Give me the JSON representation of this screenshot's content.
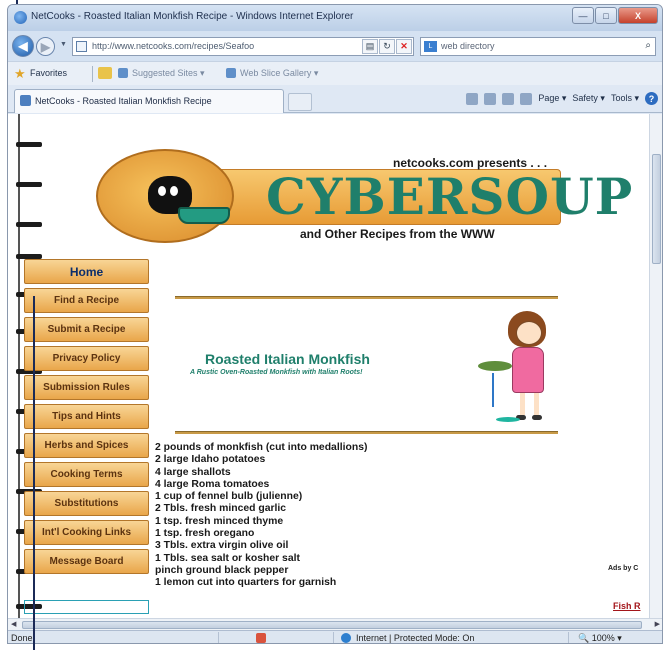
{
  "window": {
    "title": "NetCooks - Roasted Italian Monkfish Recipe - Windows Internet Explorer",
    "minimize_label": "—",
    "maximize_label": "□",
    "close_label": "X"
  },
  "address_bar": {
    "back_glyph": "◀",
    "forward_glyph": "▶",
    "url": "http://www.netcooks.com/recipes/Seafoo",
    "compat_glyph": "▤",
    "refresh_glyph": "↻",
    "stop_glyph": "✕",
    "search_placeholder": "web directory",
    "search_glyph": "⌕"
  },
  "favorites_bar": {
    "favorites_label": "Favorites",
    "links": [
      "Suggested Sites ▾",
      "Web Slice Gallery ▾"
    ]
  },
  "tabs": {
    "active_label": "NetCooks - Roasted Italian Monkfish Recipe"
  },
  "command_bar": {
    "items": [
      "Page ▾",
      "Safety ▾",
      "Tools ▾"
    ],
    "help_glyph": "?"
  },
  "site": {
    "presents": "netcooks.com presents . . .",
    "logo_text": "CYBERSOUP",
    "tagline": "and Other Recipes from the WWW"
  },
  "nav": {
    "items": [
      "Home",
      "Find a Recipe",
      "Submit a Recipe",
      "Privacy Policy",
      "Submission Rules",
      "Tips and Hints",
      "Herbs and Spices",
      "Cooking Terms",
      "Substitutions",
      "Int'l Cooking Links",
      "Message Board"
    ]
  },
  "recipe": {
    "title": "Roasted Italian Monkfish",
    "subtitle": "A Rustic Oven-Roasted Monkfish with Italian Roots!",
    "ingredients": [
      "2 pounds of monkfish (cut into medallions)",
      "2 large Idaho potatoes",
      "4 large shallots",
      "4 large Roma tomatoes",
      "1 cup of fennel bulb (julienne)",
      "2 Tbls. fresh minced garlic",
      "1 tsp. fresh minced thyme",
      "1 tsp. fresh oregano",
      "3 Tbls. extra virgin olive oil",
      "1 Tbls. sea salt or kosher salt",
      "pinch ground black pepper",
      "1 lemon cut into quarters for garnish"
    ]
  },
  "sidebar": {
    "ads_by": "Ads by C",
    "fish_link": "Fish R"
  },
  "status_bar": {
    "status": "Done",
    "zone": "Internet | Protected Mode: On",
    "zoom": "100%"
  }
}
